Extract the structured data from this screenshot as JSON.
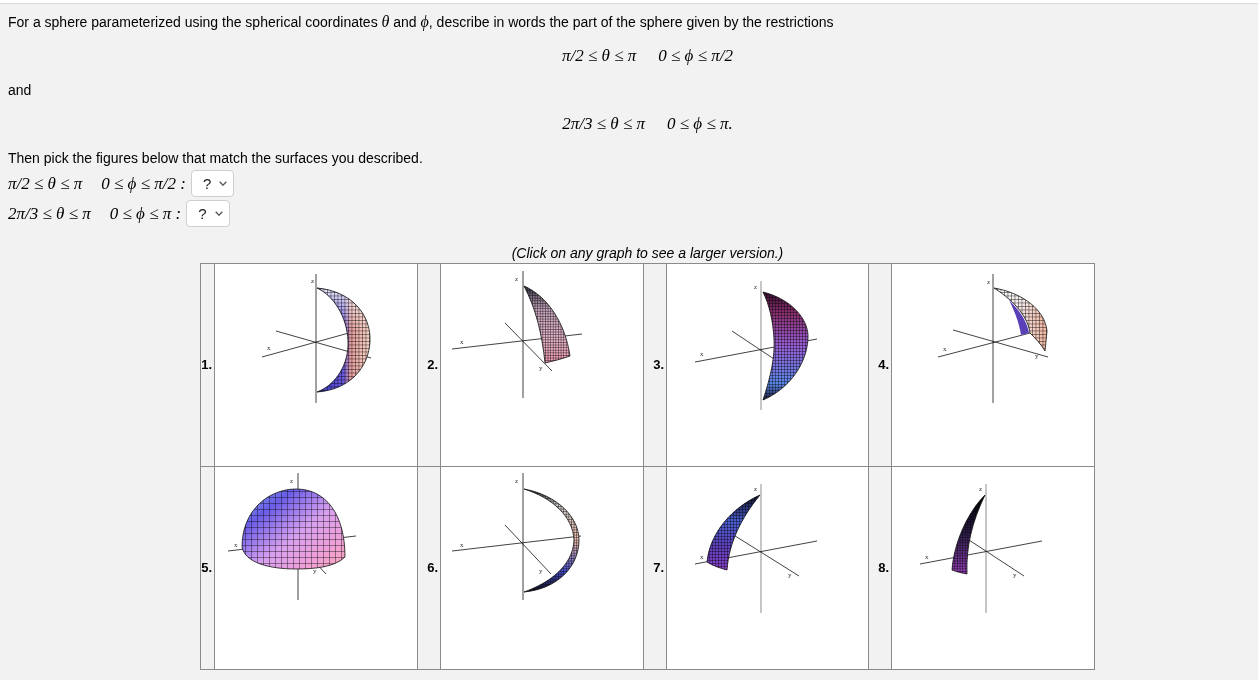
{
  "question": [
    {
      "kind": "text",
      "text": "For a sphere parameterized using the spherical coordinates *θ* and *ϕ*, describe in words the part of the sphere given by the restrictions"
    },
    {
      "kind": "math",
      "theta": "π/2 ≤ θ ≤ π",
      "phi": "0 ≤ ϕ ≤ π/2"
    },
    {
      "kind": "text",
      "text": "and"
    },
    {
      "kind": "math",
      "theta": "2π/3 ≤ θ ≤ π",
      "phi": "0 ≤ ϕ ≤ π."
    }
  ],
  "instruction": "Then pick the figures below that match the surfaces you described.",
  "answers": [
    {
      "theta": "π/2 ≤ θ ≤ π",
      "phi": "0 ≤ ϕ ≤ π/2 :",
      "choice": "?"
    },
    {
      "theta": "2π/3 ≤ θ ≤ π",
      "phi": "0 ≤ ϕ ≤ π :",
      "choice": "?"
    }
  ],
  "gallery": {
    "note": "(Click on any graph to see a larger version.)",
    "graphs": [
      {
        "label": "1.",
        "kind": "crescent",
        "axis_labels": {
          "z": "z",
          "x": "x"
        }
      },
      {
        "label": "2.",
        "kind": "wedge",
        "axis_labels": {
          "z": "z",
          "x": "x",
          "y": "y"
        }
      },
      {
        "label": "3.",
        "kind": "lune",
        "axis_labels": {
          "z": "z",
          "x": "x"
        }
      },
      {
        "label": "4.",
        "kind": "quarter",
        "axis_labels": {
          "z": "z",
          "x": "x",
          "y": "y"
        }
      },
      {
        "label": "5.",
        "kind": "dome",
        "axis_labels": {
          "z": "z",
          "x": "x",
          "y": "y"
        }
      },
      {
        "label": "6.",
        "kind": "sliver",
        "axis_labels": {
          "z": "z",
          "x": "x",
          "y": "y"
        }
      },
      {
        "label": "7.",
        "kind": "horn",
        "axis_labels": {
          "z": "z",
          "x": "x",
          "y": "y"
        }
      },
      {
        "label": "8.",
        "kind": "spike",
        "axis_labels": {
          "z": "z",
          "x": "x",
          "y": "y"
        }
      }
    ]
  }
}
